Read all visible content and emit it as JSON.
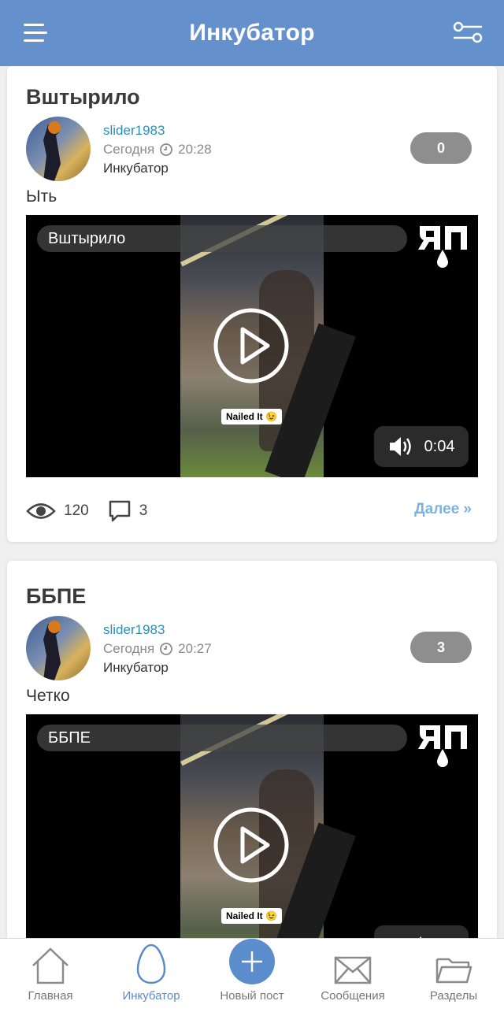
{
  "header": {
    "title": "Инкубатор",
    "menu_icon": "hamburger-icon",
    "filter_icon": "filter-sliders-icon",
    "color": "#6490cc"
  },
  "posts": [
    {
      "title": "Вштырило",
      "author": "slider1983",
      "date": "Сегодня",
      "time": "20:28",
      "section": "Инкубатор",
      "rating": "0",
      "text": "Ыть",
      "video_caption": "Вштырило",
      "video_sticker": "Nailed It 😉",
      "duration": "0:04",
      "views": "120",
      "comments": "3",
      "more": "Далее »"
    },
    {
      "title": "ББПЕ",
      "author": "slider1983",
      "date": "Сегодня",
      "time": "20:27",
      "section": "Инкубатор",
      "rating": "3",
      "text": "Четко",
      "video_caption": "ББПЕ",
      "video_sticker": "Nailed It 😉"
    }
  ],
  "bottom_nav": [
    {
      "label": "Главная",
      "icon": "home-icon",
      "active": false
    },
    {
      "label": "Инкубатор",
      "icon": "egg-icon",
      "active": true
    },
    {
      "label": "Новый пост",
      "icon": "plus-icon",
      "active": false
    },
    {
      "label": "Сообщения",
      "icon": "envelope-icon",
      "active": false
    },
    {
      "label": "Разделы",
      "icon": "folder-icon",
      "active": false
    }
  ],
  "colors": {
    "accent": "#5b8ccc",
    "link": "#2a8fb3",
    "more_link": "#7db2e0",
    "rating_bg": "#8e8e8e"
  }
}
